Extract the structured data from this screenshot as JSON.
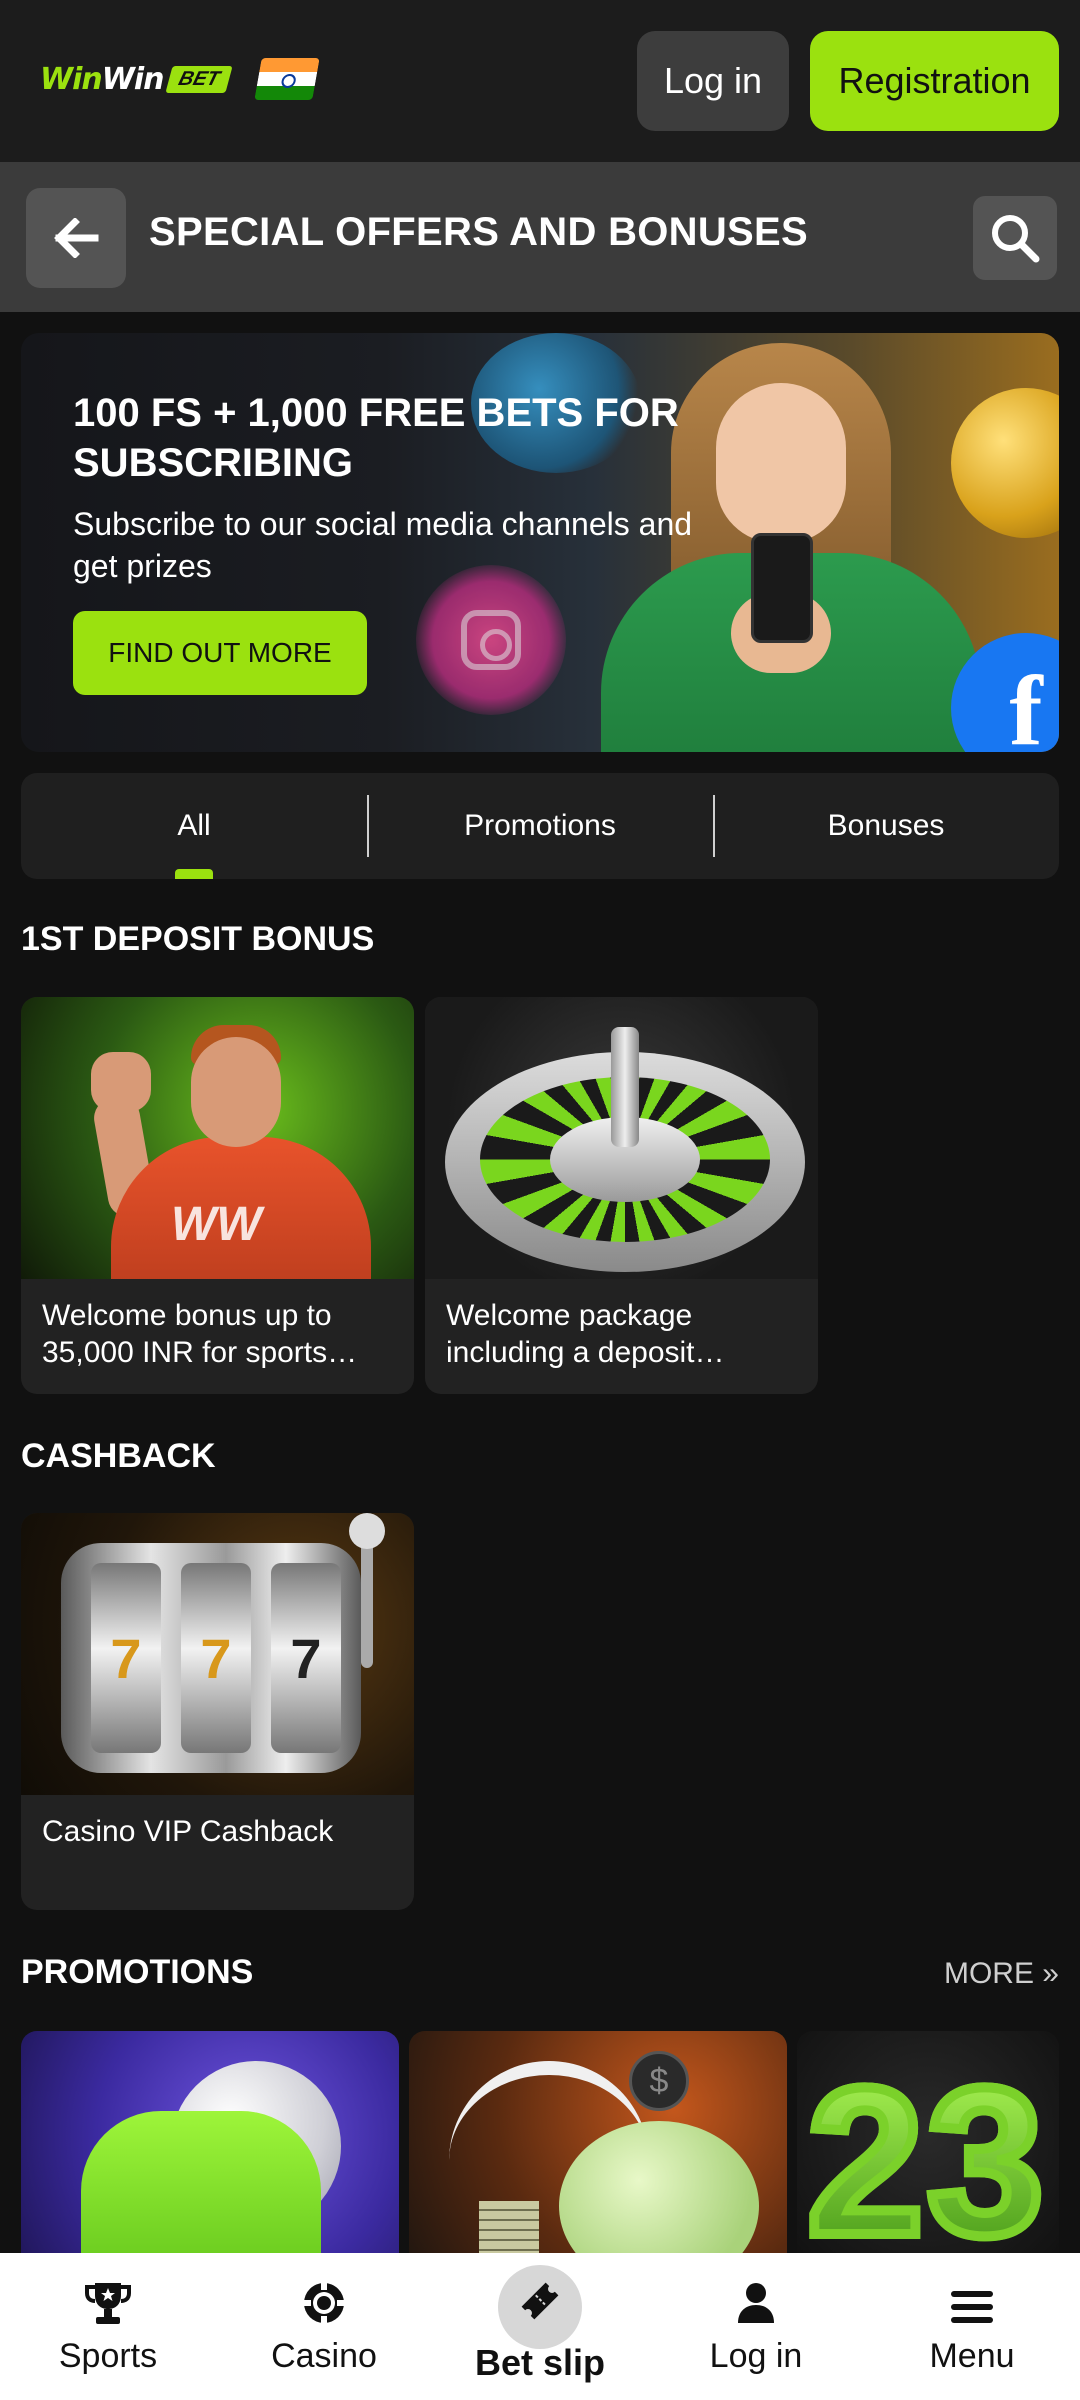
{
  "header": {
    "logo_win_1": "Win",
    "logo_win_2": "Win",
    "logo_bet": "BET",
    "login_label": "Log in",
    "register_label": "Registration"
  },
  "titlebar": {
    "title": "SPECIAL OFFERS AND BONUSES"
  },
  "banner": {
    "title": "100 FS + 1,000 FREE BETS FOR SUBSCRIBING",
    "subtitle": "Subscribe to our social media channels and get prizes",
    "cta_label": "FIND OUT MORE",
    "fb_letter": "f"
  },
  "tabs": [
    {
      "label": "All",
      "active": true
    },
    {
      "label": "Promotions",
      "active": false
    },
    {
      "label": "Bonuses",
      "active": false
    }
  ],
  "sections": {
    "deposit": {
      "title": "1ST DEPOSIT BONUS",
      "cards": [
        {
          "text": "Welcome bonus up to 35,000 INR for sports…",
          "image": "footballer"
        },
        {
          "text": "Welcome package including a deposit…",
          "image": "roulette-wheel"
        }
      ]
    },
    "cashback": {
      "title": "CASHBACK",
      "cards": [
        {
          "text": "Casino VIP Cashback",
          "image": "slot-machine",
          "reels": [
            "7",
            "7",
            "7"
          ]
        }
      ]
    },
    "promotions": {
      "title": "PROMOTIONS",
      "more_label": "MORE »",
      "promo3_digits": [
        "2",
        "3"
      ],
      "promo2_coin": "$"
    }
  },
  "bottom_nav": [
    {
      "label": "Sports",
      "icon": "trophy-icon"
    },
    {
      "label": "Casino",
      "icon": "chip-icon"
    },
    {
      "label": "Bet slip",
      "icon": "ticket-icon"
    },
    {
      "label": "Log in",
      "icon": "user-icon"
    },
    {
      "label": "Menu",
      "icon": "menu-icon"
    }
  ],
  "colors": {
    "accent": "#9be10f",
    "background": "#111111",
    "header": "#1c1c1c",
    "titlebar": "#3b3b3b",
    "card": "#222222"
  }
}
